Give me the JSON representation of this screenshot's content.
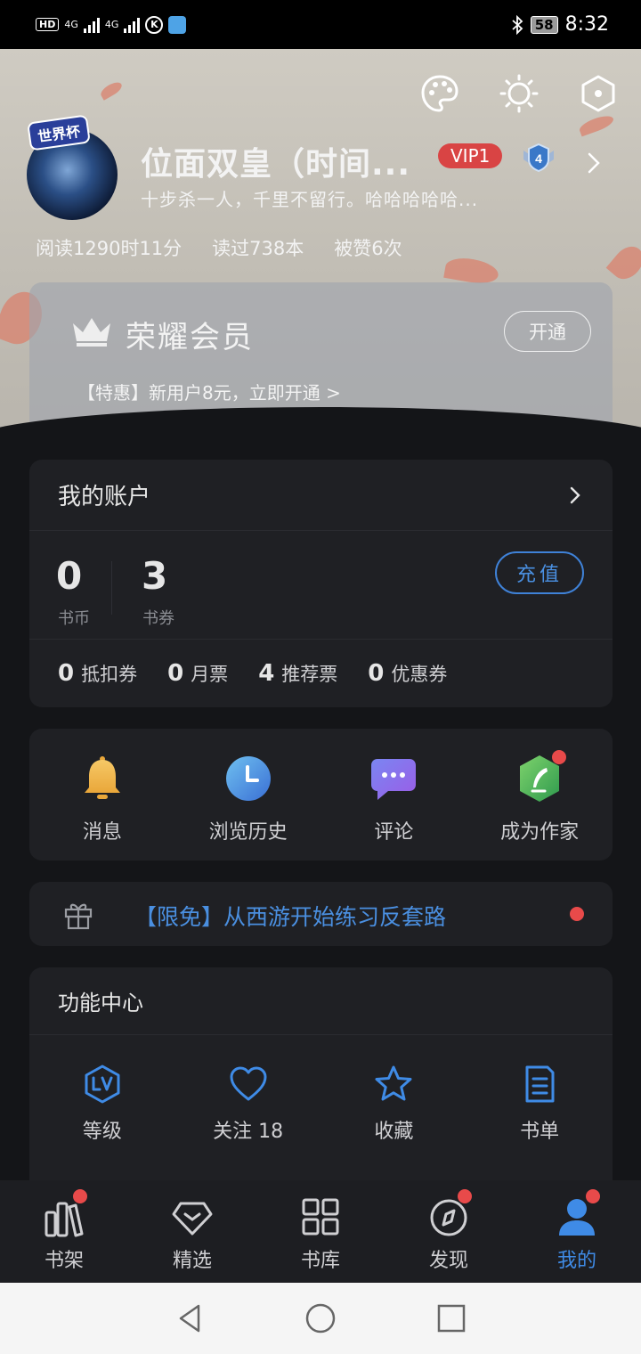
{
  "status_bar": {
    "hd": "HD",
    "net1": "4G",
    "net2": "4G",
    "app_k": "K",
    "battery": "58",
    "time": "8:32"
  },
  "profile": {
    "avatar_tag": "世界杯",
    "nickname": "位面双皇（时间...",
    "vip": "VIP1",
    "level": "4",
    "signature": "十步杀一人，千里不留行。哈哈哈哈哈...",
    "stats": [
      "阅读1290时11分",
      "读过738本",
      "被赞6次"
    ]
  },
  "member": {
    "title": "荣耀会员",
    "open_label": "开通",
    "promo": "【特惠】新用户8元，立即开通 >"
  },
  "account": {
    "title": "我的账户",
    "coins": "0",
    "coins_label": "书币",
    "vouchers": "3",
    "vouchers_label": "书券",
    "recharge_label": "充值",
    "tickets": [
      {
        "n": "0",
        "l": "抵扣券"
      },
      {
        "n": "0",
        "l": "月票"
      },
      {
        "n": "4",
        "l": "推荐票"
      },
      {
        "n": "0",
        "l": "优惠券"
      }
    ]
  },
  "quick": [
    {
      "label": "消息",
      "icon": "bell-icon"
    },
    {
      "label": "浏览历史",
      "icon": "clock-icon"
    },
    {
      "label": "评论",
      "icon": "comment-icon"
    },
    {
      "label": "成为作家",
      "icon": "pen-icon"
    }
  ],
  "banner": {
    "text": "【限免】从西游开始练习反套路"
  },
  "functions": {
    "title": "功能中心",
    "items": [
      {
        "label": "等级",
        "icon": "level-icon"
      },
      {
        "label": "关注 18",
        "icon": "heart-icon"
      },
      {
        "label": "收藏",
        "icon": "star-icon"
      },
      {
        "label": "书单",
        "icon": "booklist-icon"
      }
    ]
  },
  "tabs": [
    {
      "label": "书架",
      "icon": "bookshelf-icon"
    },
    {
      "label": "精选",
      "icon": "diamond-icon"
    },
    {
      "label": "书库",
      "icon": "grid-icon"
    },
    {
      "label": "发现",
      "icon": "compass-icon"
    },
    {
      "label": "我的",
      "icon": "person-icon"
    }
  ],
  "colors": {
    "accent": "#3f8be6",
    "badge_red": "#e84a4a",
    "vip_red": "#d94444",
    "background": "#141518",
    "card": "#1f2024"
  }
}
